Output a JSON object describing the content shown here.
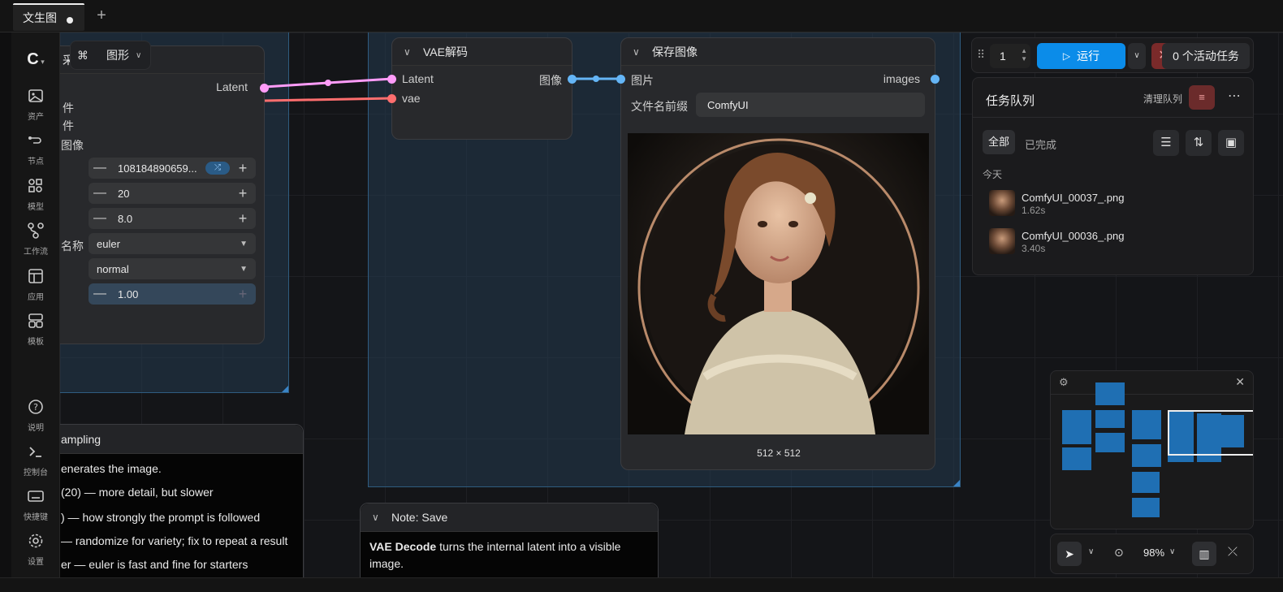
{
  "tabs": {
    "active_label": "文生图",
    "add_label": "+"
  },
  "sidebar": {
    "items": [
      {
        "label": "资产",
        "icon": "image-icon"
      },
      {
        "label": "节点",
        "icon": "node-icon"
      },
      {
        "label": "模型",
        "icon": "model-icon"
      },
      {
        "label": "工作流",
        "icon": "workflow-icon"
      },
      {
        "label": "应用",
        "icon": "app-icon"
      },
      {
        "label": "模板",
        "icon": "template-icon"
      }
    ],
    "bottom_items": [
      {
        "label": "说明",
        "icon": "help-icon"
      },
      {
        "label": "控制台",
        "icon": "terminal-icon"
      },
      {
        "label": "快捷键",
        "icon": "keyboard-icon"
      },
      {
        "label": "设置",
        "icon": "gear-icon"
      }
    ]
  },
  "graph_toggle": {
    "label": "图形"
  },
  "ksampler": {
    "title_fragment": "采",
    "output": "Latent",
    "left_labels": [
      "件",
      "件",
      "图像",
      "名称"
    ],
    "widgets": {
      "seed": "108184890659...",
      "steps": "20",
      "cfg": "8.0",
      "sampler": "euler",
      "scheduler": "normal",
      "denoise": "1.00"
    }
  },
  "vae_node": {
    "title": "VAE解码",
    "inputs": [
      "Latent",
      "vae"
    ],
    "output": "图像"
  },
  "save_node": {
    "title": "保存图像",
    "input": "图片",
    "output": "images",
    "prefix_label": "文件名前缀",
    "prefix_value": "ComfyUI",
    "image_size": "512 × 512"
  },
  "note_sampling": {
    "title": "ampling",
    "lines": [
      "enerates the image.",
      "(20) — more detail, but slower",
      ") — how strongly the prompt is followed",
      "— randomize for variety; fix to repeat a result",
      "er — euler is fast and fine for starters"
    ],
    "last_line_bold": "er"
  },
  "note_save": {
    "title": "Note: Save",
    "bold": "VAE Decode",
    "text": " turns the internal latent into a visible",
    "text2": "image."
  },
  "runbar": {
    "count": "1",
    "run_label": "运行",
    "active_tasks": "0 个活动任务"
  },
  "queue": {
    "title": "任务队列",
    "clear_label": "清理队列",
    "filter_all": "全部",
    "filter_done": "已完成",
    "section": "今天",
    "items": [
      {
        "name": "ComfyUI_00037_.png",
        "time": "1.62s"
      },
      {
        "name": "ComfyUI_00036_.png",
        "time": "3.40s"
      }
    ]
  },
  "zoom": {
    "level": "98%"
  },
  "colors": {
    "accent": "#0b8ce9",
    "latent_link": "#ff9cf9",
    "vae_link": "#ff6e6e",
    "image_link": "#64b5f6",
    "group": "#2f5c80",
    "stop": "#7a2a2a"
  }
}
